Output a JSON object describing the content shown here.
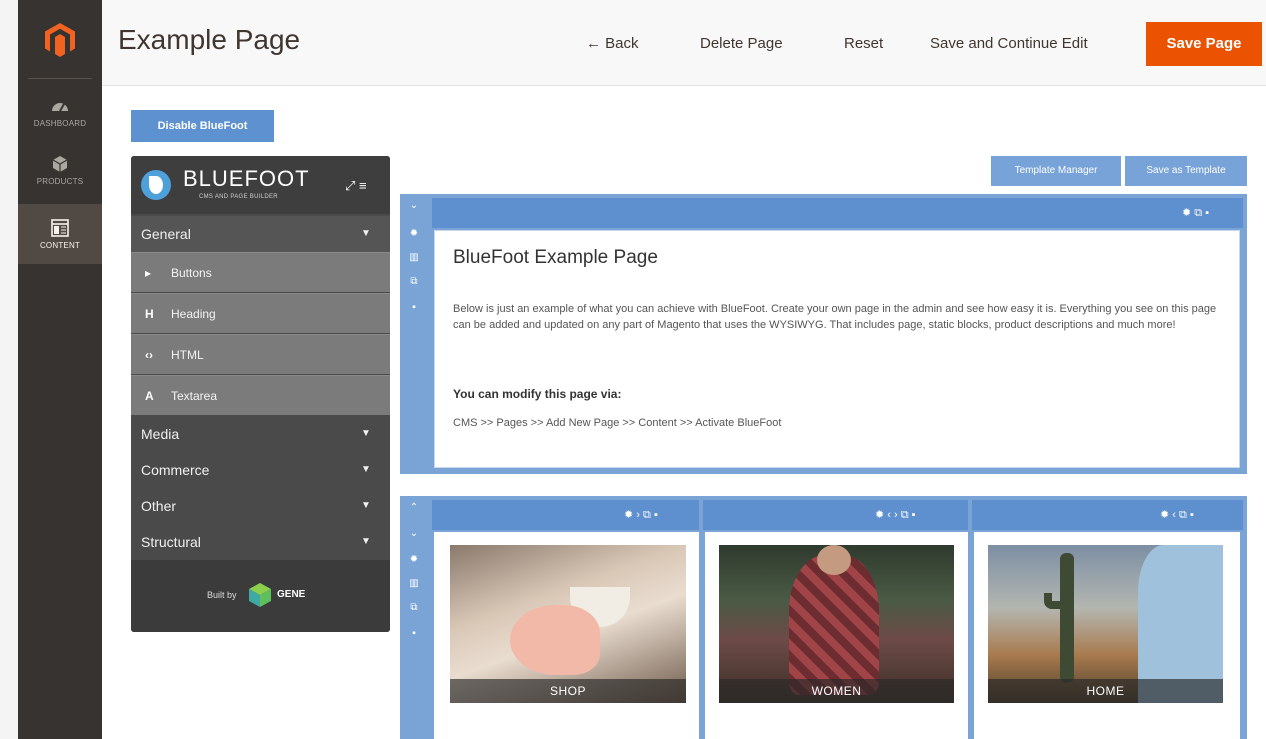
{
  "header": {
    "title": "Example Page",
    "back_label": "← Back",
    "delete_label": "Delete Page",
    "reset_label": "Reset",
    "save_continue_label": "Save and Continue Edit",
    "save_label": "Save Page"
  },
  "admin_nav": {
    "items": [
      {
        "label": "DASHBOARD",
        "icon": "dashboard-icon"
      },
      {
        "label": "PRODUCTS",
        "icon": "cube-icon"
      },
      {
        "label": "CONTENT",
        "icon": "content-icon",
        "active": true
      }
    ]
  },
  "toolbar": {
    "disable_label": "Disable BlueFoot",
    "template_manager_label": "Template Manager",
    "save_template_label": "Save as Template"
  },
  "bluefoot": {
    "title": "BLUEFOOT",
    "subtitle": "CMS AND PAGE BUILDER",
    "sections": {
      "general": "General",
      "media": "Media",
      "commerce": "Commerce",
      "other": "Other",
      "structural": "Structural"
    },
    "general_items": [
      {
        "icon": "▸",
        "label": "Buttons"
      },
      {
        "icon": "H",
        "label": "Heading"
      },
      {
        "icon": "‹›",
        "label": "HTML"
      },
      {
        "icon": "A",
        "label": "Textarea"
      }
    ],
    "built_by": "Built by",
    "gene": "GENE"
  },
  "row1": {
    "heading": "BlueFoot Example Page",
    "paragraph": "Below is just an example of what you can achieve with BlueFoot.  Create your own page in the admin and see how easy it is. Everything you see on this page can be added and updated on any part of Magento that uses the WYSIWYG. That includes page, static blocks, product descriptions and much more!",
    "strong": "You can modify this page via:",
    "path": "CMS >> Pages >> Add New Page >> Content >> Activate BlueFoot"
  },
  "row2": {
    "tiles": [
      {
        "label": "SHOP"
      },
      {
        "label": "WOMEN"
      },
      {
        "label": "HOME"
      }
    ]
  },
  "colors": {
    "accent": "#eb5202",
    "bluefoot_blue": "#5e8fcf",
    "admin_nav": "#373330"
  }
}
